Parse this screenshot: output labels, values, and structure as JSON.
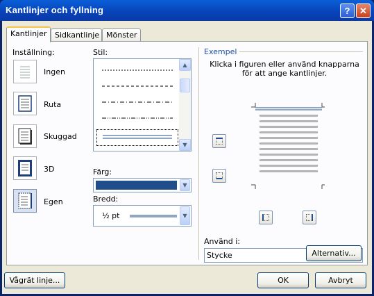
{
  "window": {
    "title": "Kantlinjer och fyllning",
    "help_glyph": "?",
    "close_glyph": "✕"
  },
  "tabs": [
    {
      "label": "Kantlinjer",
      "active": true
    },
    {
      "label": "Sidkantlinje",
      "active": false
    },
    {
      "label": "Mönster",
      "active": false
    }
  ],
  "setting": {
    "heading": "Inställning:",
    "options": [
      {
        "label": "Ingen"
      },
      {
        "label": "Ruta"
      },
      {
        "label": "Skuggad"
      },
      {
        "label": "3D"
      },
      {
        "label": "Egen",
        "selected": true
      }
    ]
  },
  "style": {
    "heading": "Stil:",
    "lines": [
      "dashed-fine",
      "dashed",
      "dash-dot",
      "dash-dot-dot",
      "double"
    ],
    "selected": "double"
  },
  "color": {
    "label": "Färg:",
    "value": "#1f4e8a"
  },
  "width": {
    "label": "Bredd:",
    "value": "½ pt"
  },
  "preview": {
    "heading": "Exempel",
    "instruction": "Klicka i figuren eller använd knapparna för att ange kantlinjer."
  },
  "apply_to": {
    "label": "Använd i:",
    "value": "Stycke"
  },
  "buttons": {
    "options": "Alternativ...",
    "horizontal_line": "Vågrät linje...",
    "ok": "OK",
    "cancel": "Avbryt"
  }
}
